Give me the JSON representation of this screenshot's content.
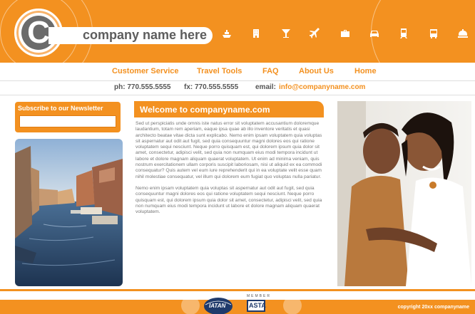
{
  "brand": {
    "logo_letter": "C",
    "company_name": "company name here",
    "accent_color": "#f39120"
  },
  "header_icons": [
    "cruise-ship-icon",
    "hotel-icon",
    "cocktail-icon",
    "airplane-icon",
    "briefcase-icon",
    "car-icon",
    "train-icon",
    "bus-icon",
    "concierge-bell-icon"
  ],
  "nav": {
    "items": [
      "Customer Service",
      "Travel Tools",
      "FAQ",
      "About Us",
      "Home"
    ]
  },
  "contact": {
    "phone": "ph: 770.555.5555",
    "fax": "fx: 770.555.5555",
    "email_label": "email:",
    "email_value": "info@companyname.com"
  },
  "newsletter": {
    "title": "Subscribe to our Newsletter",
    "input_value": ""
  },
  "welcome": {
    "title": "Welcome to companyname.com",
    "paragraph_1": "Sed ut perspiciatis unde omnis iste natus error sit voluptatem accusantium doloremque laudantium, totam rem aperiam, eaque ipsa quae ab illo inventore veritatis et quasi architecto beatae vitae dicta sunt explicabo. Nemo enim ipsam voluptatem quia voluptas sit aspernatur aut odit aut fugit, sed quia consequuntur magni dolores eos qui ratione voluptatem sequi nesciunt. Neque porro quisquam est, qui dolorem ipsum quia dolor sit amet, consectetur, adipisci velit, sed quia non numquam eius modi tempora incidunt ut labore et dolore magnam aliquam quaerat voluptatem. Ut enim ad minima veniam, quis nostrum exercitationem ullam corporis suscipit laboriosam, nisi ut aliquid ex ea commodi consequatur? Quis autem vel eum iure reprehenderit qui in ea voluptate velit esse quam nihil molestiae consequatur, vel illum qui dolorem eum fugiat quo voluptas nulla pariatur.",
    "paragraph_2": "Nemo enim ipsam voluptatem quia voluptas sit aspernatur aut odit aut fugit, sed quia consequuntur magni dolores eos qui ratione voluptatem sequi nesciunt. Neque porro quisquam est, qui dolorem ipsum quia dolor sit amet, consectetur, adipisci velit, sed quia non numquam eius modi tempora incidunt ut labore et dolore magnam aliquam quaerat voluptatem."
  },
  "footer": {
    "badge_1": "IATAN",
    "badge_2_top": "MEMBER",
    "badge_2": "ASTA",
    "copyright": "copyright 20xx companyname"
  }
}
